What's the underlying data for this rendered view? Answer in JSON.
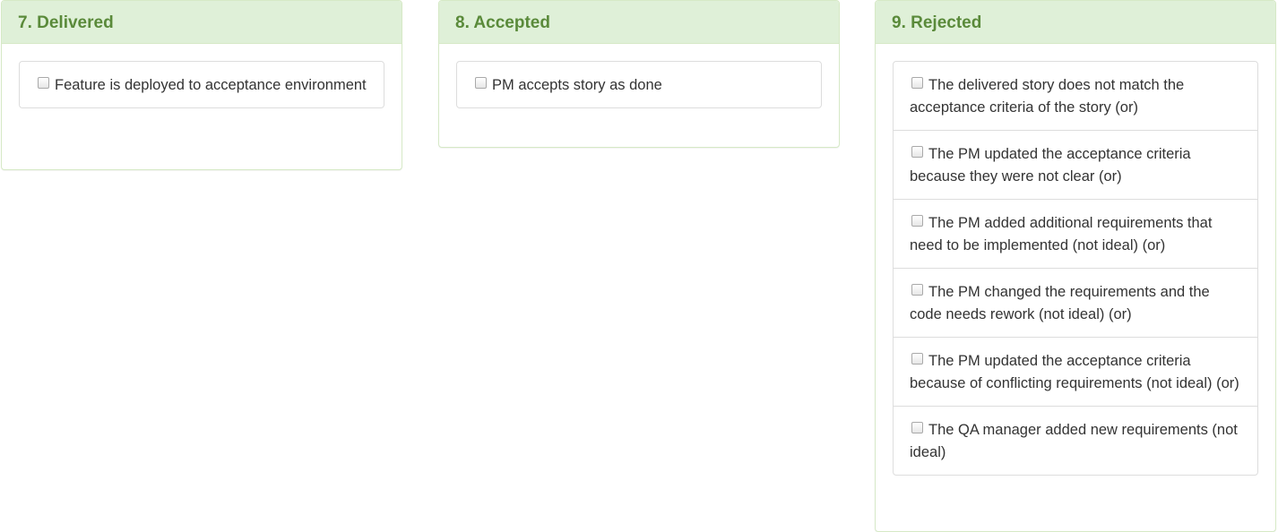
{
  "panels": [
    {
      "title": "7. Delivered",
      "items": [
        "Feature is deployed to acceptance environment"
      ]
    },
    {
      "title": "8. Accepted",
      "items": [
        "PM accepts story as done"
      ]
    },
    {
      "title": "9. Rejected",
      "items": [
        "The delivered story does not match the acceptance criteria of the story (or)",
        "The PM updated the acceptance criteria because they were not clear (or)",
        "The PM added additional requirements that need to be implemented (not ideal) (or)",
        "The PM changed the requirements and the code needs rework (not ideal) (or)",
        "The PM updated the acceptance criteria because of conflicting requirements (not ideal) (or)",
        "The QA manager added new requirements (not ideal)"
      ]
    }
  ],
  "colors": {
    "heading_bg": "#dff0d8",
    "heading_text": "#5a8a3a",
    "border": "#d6e9c6"
  }
}
